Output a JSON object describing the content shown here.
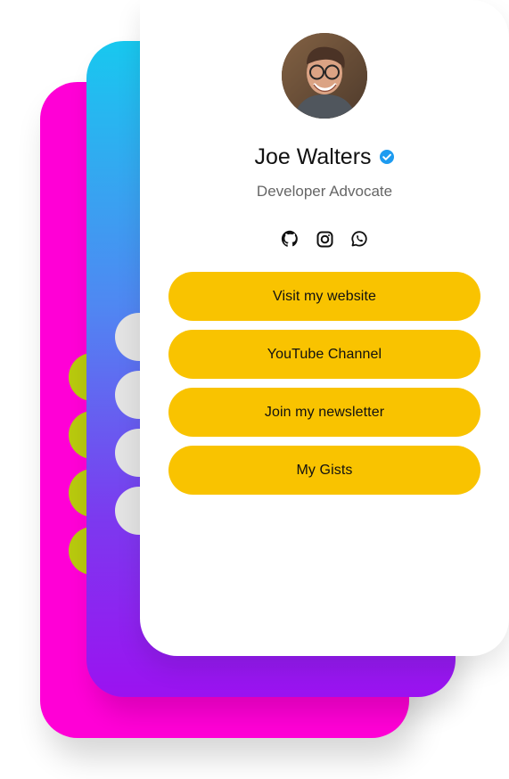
{
  "profile": {
    "name": "Joe Walters",
    "role": "Developer Advocate"
  },
  "social": [
    {
      "icon": "github-icon"
    },
    {
      "icon": "instagram-icon"
    },
    {
      "icon": "whatsapp-icon"
    }
  ],
  "links": [
    {
      "label": "Visit my website"
    },
    {
      "label": "YouTube Channel"
    },
    {
      "label": "Join my newsletter"
    },
    {
      "label": "My Gists"
    }
  ],
  "colors": {
    "back_card": "#ff00d6",
    "mid_gradient_top": "#18c8ef",
    "mid_gradient_bottom": "#9b12f0",
    "button_fill": "#f9c300",
    "verified_blue": "#1d9bf0",
    "green_pill": "#b8c90e",
    "gray_pill": "#e3e3e3"
  }
}
